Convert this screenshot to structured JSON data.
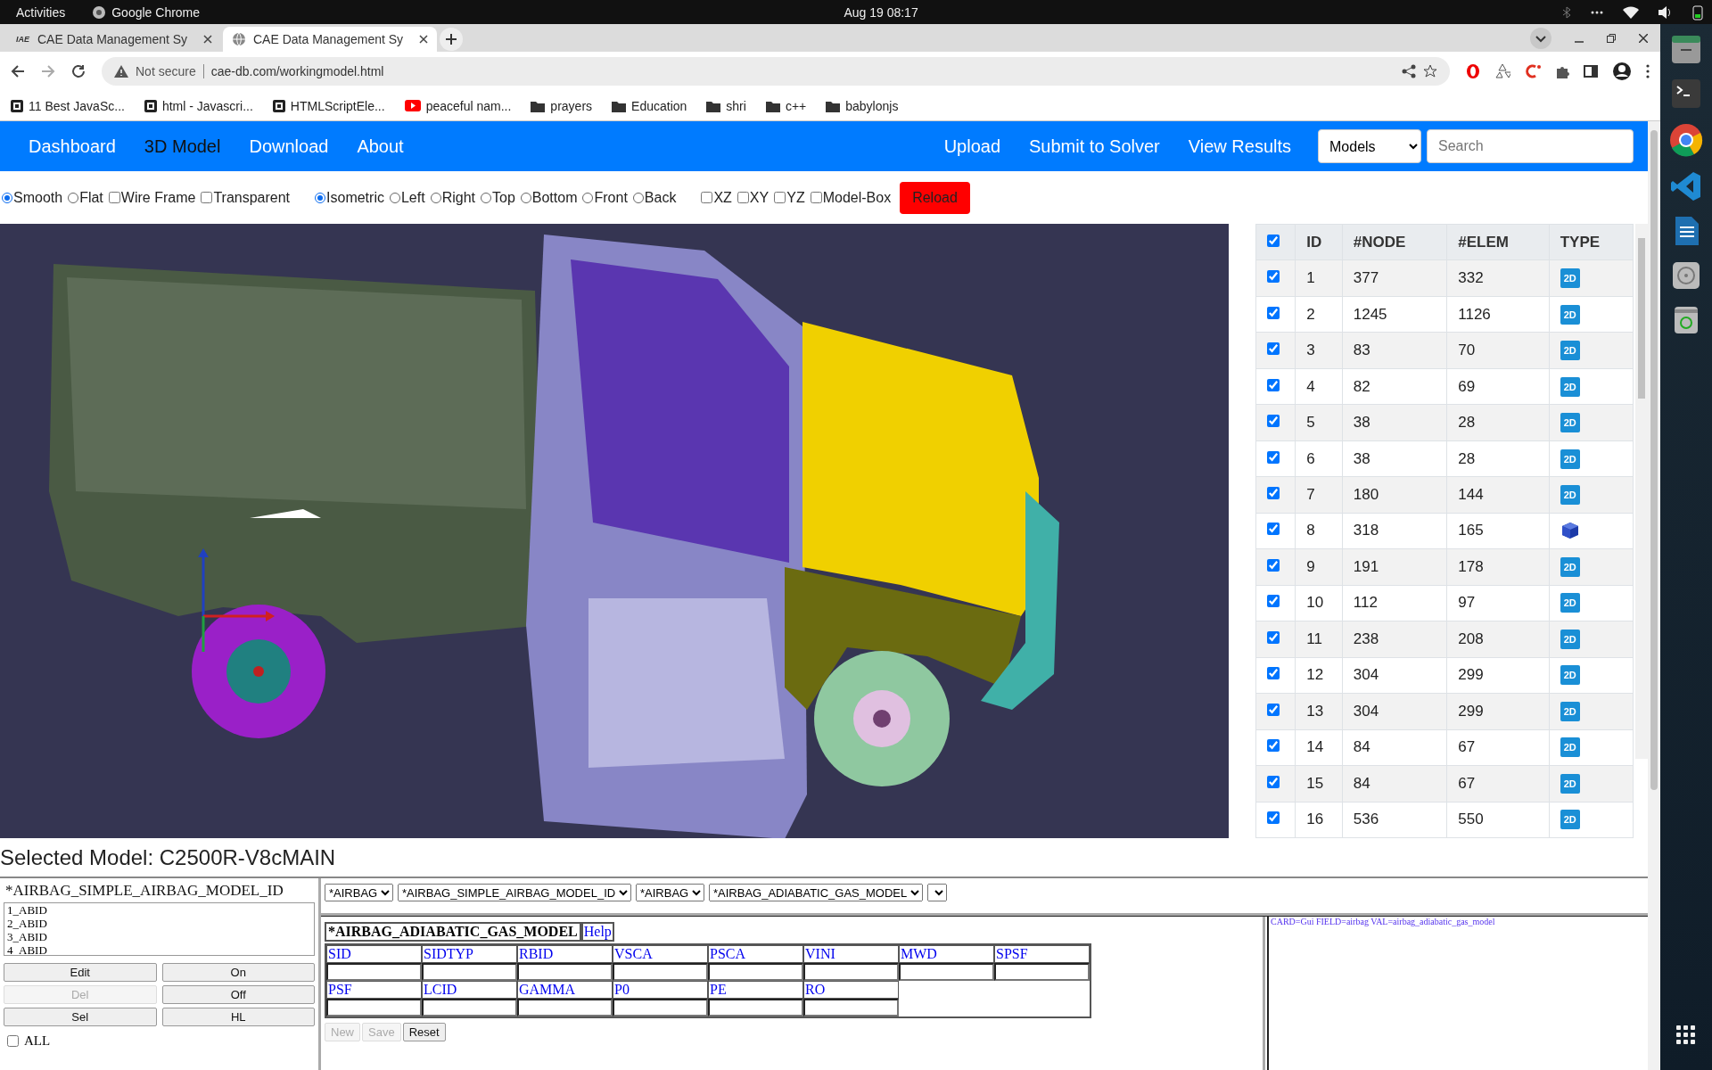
{
  "system_bar": {
    "activities": "Activities",
    "app_name": "Google Chrome",
    "clock": "Aug 19  08:17"
  },
  "browser": {
    "tabs": [
      {
        "title": "CAE Data Management Sy",
        "favicon_text": "IAE",
        "selected": false
      },
      {
        "title": "CAE Data Management Sy",
        "selected": true
      }
    ],
    "address": {
      "security": "Not secure",
      "url": "cae-db.com/workingmodel.html"
    },
    "bookmarks": [
      {
        "label": "11 Best JavaSc...",
        "kind": "site"
      },
      {
        "label": "html - Javascri...",
        "kind": "site"
      },
      {
        "label": "HTMLScriptEle...",
        "kind": "site"
      },
      {
        "label": "peaceful nam...",
        "kind": "video"
      },
      {
        "label": "prayers",
        "kind": "folder"
      },
      {
        "label": "Education",
        "kind": "folder"
      },
      {
        "label": "shri",
        "kind": "folder"
      },
      {
        "label": "c++",
        "kind": "folder"
      },
      {
        "label": "babylonjs",
        "kind": "folder"
      }
    ]
  },
  "nav": {
    "left": [
      {
        "label": "Dashboard",
        "selected": false
      },
      {
        "label": "3D Model",
        "selected": true
      },
      {
        "label": "Download",
        "selected": false
      },
      {
        "label": "About",
        "selected": false
      }
    ],
    "right": [
      {
        "label": "Upload"
      },
      {
        "label": "Submit to Solver"
      },
      {
        "label": "View Results"
      }
    ],
    "select": "Models",
    "search": {
      "placeholder": "Search"
    }
  },
  "view_options": [
    {
      "label": "Smooth",
      "kind": "radio",
      "checked": true
    },
    {
      "label": "Flat",
      "kind": "radio",
      "checked": false
    },
    {
      "label": "Wire Frame",
      "kind": "checkbox",
      "checked": false
    },
    {
      "label": "Transparent",
      "kind": "checkbox",
      "checked": false
    },
    {
      "label": "Isometric",
      "kind": "radio",
      "checked": true
    },
    {
      "label": "Left",
      "kind": "radio",
      "checked": false
    },
    {
      "label": "Right",
      "kind": "radio",
      "checked": false
    },
    {
      "label": "Top",
      "kind": "radio",
      "checked": false
    },
    {
      "label": "Bottom",
      "kind": "radio",
      "checked": false
    },
    {
      "label": "Front",
      "kind": "radio",
      "checked": false
    },
    {
      "label": "Back",
      "kind": "radio",
      "checked": false
    },
    {
      "label": "XZ",
      "kind": "checkbox",
      "checked": false
    },
    {
      "label": "XY",
      "kind": "checkbox",
      "checked": false
    },
    {
      "label": "YZ",
      "kind": "checkbox",
      "checked": false
    },
    {
      "label": "Model-Box",
      "kind": "checkbox",
      "checked": false
    }
  ],
  "reload_button": "Reload",
  "parts_table": {
    "all_checked": true,
    "columns": [
      "ID",
      "#NODE",
      "#ELEM",
      "TYPE"
    ],
    "rows": [
      {
        "checked": true,
        "id": "1",
        "nodes": "377",
        "elems": "332",
        "kind": "shell",
        "type": "2D"
      },
      {
        "checked": true,
        "id": "2",
        "nodes": "1245",
        "elems": "1126",
        "kind": "shell",
        "type": "2D"
      },
      {
        "checked": true,
        "id": "3",
        "nodes": "83",
        "elems": "70",
        "kind": "shell",
        "type": "2D"
      },
      {
        "checked": true,
        "id": "4",
        "nodes": "82",
        "elems": "69",
        "kind": "shell",
        "type": "2D"
      },
      {
        "checked": true,
        "id": "5",
        "nodes": "38",
        "elems": "28",
        "kind": "shell",
        "type": "2D"
      },
      {
        "checked": true,
        "id": "6",
        "nodes": "38",
        "elems": "28",
        "kind": "shell",
        "type": "2D"
      },
      {
        "checked": true,
        "id": "7",
        "nodes": "180",
        "elems": "144",
        "kind": "shell",
        "type": "2D"
      },
      {
        "checked": true,
        "id": "8",
        "nodes": "318",
        "elems": "165",
        "kind": "solid"
      },
      {
        "checked": true,
        "id": "9",
        "nodes": "191",
        "elems": "178",
        "kind": "shell",
        "type": "2D"
      },
      {
        "checked": true,
        "id": "10",
        "nodes": "112",
        "elems": "97",
        "kind": "shell",
        "type": "2D"
      },
      {
        "checked": true,
        "id": "11",
        "nodes": "238",
        "elems": "208",
        "kind": "shell",
        "type": "2D"
      },
      {
        "checked": true,
        "id": "12",
        "nodes": "304",
        "elems": "299",
        "kind": "shell",
        "type": "2D"
      },
      {
        "checked": true,
        "id": "13",
        "nodes": "304",
        "elems": "299",
        "kind": "shell",
        "type": "2D"
      },
      {
        "checked": true,
        "id": "14",
        "nodes": "84",
        "elems": "67",
        "kind": "shell",
        "type": "2D"
      },
      {
        "checked": true,
        "id": "15",
        "nodes": "84",
        "elems": "67",
        "kind": "shell",
        "type": "2D"
      },
      {
        "checked": true,
        "id": "16",
        "nodes": "536",
        "elems": "550",
        "kind": "shell",
        "type": "2D"
      }
    ]
  },
  "selected_model": "Selected Model: C2500R-V8cMAIN",
  "keyword_panel": {
    "title": "*AIRBAG_SIMPLE_AIRBAG_MODEL_ID",
    "items": [
      "1_ABID",
      "2_ABID",
      "3_ABID",
      "4_ABID"
    ],
    "buttons": [
      {
        "label": "Edit",
        "disabled": false
      },
      {
        "label": "On",
        "disabled": false
      },
      {
        "label": "Del",
        "disabled": true
      },
      {
        "label": "Off",
        "disabled": false
      },
      {
        "label": "Sel",
        "disabled": false
      },
      {
        "label": "HL",
        "disabled": false
      }
    ],
    "all": {
      "label": "ALL",
      "checked": false
    }
  },
  "card_selects": [
    "*AIRBAG",
    "*AIRBAG_SIMPLE_AIRBAG_MODEL_ID",
    "*AIRBAG",
    "*AIRBAG_ADIABATIC_GAS_MODEL"
  ],
  "card": {
    "title": "*AIRBAG_ADIABATIC_GAS_MODEL",
    "help": "Help",
    "field_rows": [
      [
        "SID",
        "SIDTYP",
        "RBID",
        "VSCA",
        "PSCA",
        "VINI",
        "MWD",
        "SPSF"
      ],
      [
        "PSF",
        "LCID",
        "GAMMA",
        "P0",
        "PE",
        "RO"
      ]
    ],
    "buttons": [
      {
        "label": "New",
        "disabled": true
      },
      {
        "label": "Save",
        "disabled": true
      },
      {
        "label": "Reset",
        "disabled": false
      }
    ]
  },
  "info_text": "CARD=Gui FIELD=airbag VAL=airbag_adiabatic_gas_model"
}
